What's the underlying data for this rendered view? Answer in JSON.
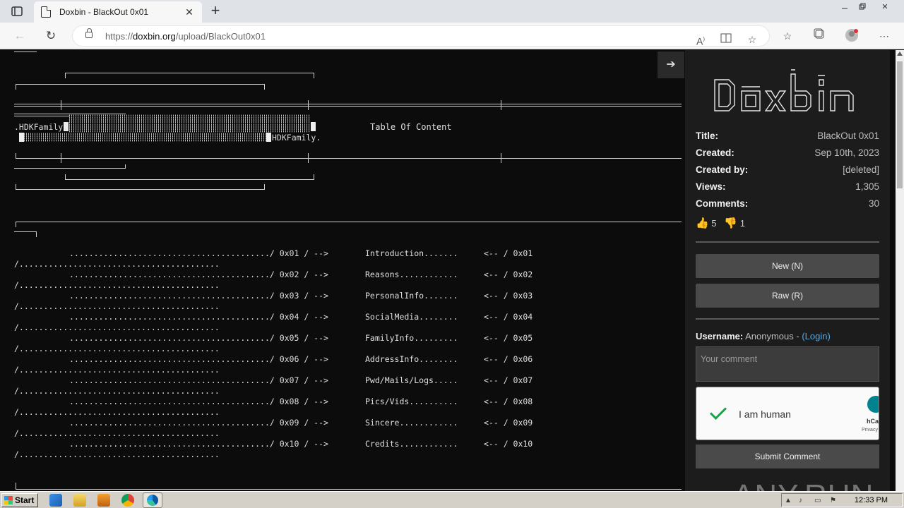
{
  "browser": {
    "tab_title": "Doxbin - BlackOut 0x01",
    "url_prefix": "https://",
    "url_domain": "doxbin.org",
    "url_path": "/upload/BlackOut0x01"
  },
  "paste": {
    "banner_left": ".HDKFamily.",
    "banner_right": "HDKFamily.",
    "banner_heading": "Table Of Content",
    "toc": [
      {
        "lead": "........................................./ 0x01 / -->",
        "trail": "/.........................................",
        "name": "Introduction.......",
        "ref": "<-- / 0x01"
      },
      {
        "lead": "........................................./ 0x02 / -->",
        "trail": "/.........................................",
        "name": "Reasons............",
        "ref": "<-- / 0x02"
      },
      {
        "lead": "........................................./ 0x03 / -->",
        "trail": "/.........................................",
        "name": "PersonalInfo.......",
        "ref": "<-- / 0x03"
      },
      {
        "lead": "........................................./ 0x04 / -->",
        "trail": "/.........................................",
        "name": "SocialMedia........",
        "ref": "<-- / 0x04"
      },
      {
        "lead": "........................................./ 0x05 / -->",
        "trail": "/.........................................",
        "name": "FamilyInfo.........",
        "ref": "<-- / 0x05"
      },
      {
        "lead": "........................................./ 0x06 / -->",
        "trail": "/.........................................",
        "name": "AddressInfo........",
        "ref": "<-- / 0x06"
      },
      {
        "lead": "........................................./ 0x07 / -->",
        "trail": "/.........................................",
        "name": "Pwd/Mails/Logs.....",
        "ref": "<-- / 0x07"
      },
      {
        "lead": "........................................./ 0x08 / -->",
        "trail": "/.........................................",
        "name": "Pics/Vids..........",
        "ref": "<-- / 0x08"
      },
      {
        "lead": "........................................./ 0x09 / -->",
        "trail": "/.........................................",
        "name": "Sincere............",
        "ref": "<-- / 0x09"
      },
      {
        "lead": "........................................./ 0x10 / -->",
        "trail": "/.........................................",
        "name": "Credits............",
        "ref": "<-- / 0x10"
      }
    ]
  },
  "sidebar": {
    "meta": [
      {
        "key": "Title:",
        "value": "BlackOut 0x01"
      },
      {
        "key": "Created:",
        "value": "Sep 10th, 2023"
      },
      {
        "key": "Created by:",
        "value": "[deleted]"
      },
      {
        "key": "Views:",
        "value": "1,305"
      },
      {
        "key": "Comments:",
        "value": "30"
      }
    ],
    "likes": "5",
    "dislikes": "1",
    "new_button": "New (N)",
    "raw_button": "Raw (R)",
    "username_label": "Username:",
    "username_value": "Anonymous -",
    "login_link": "(Login)",
    "comment_placeholder": "Your comment",
    "captcha_label": "I am human",
    "captcha_brand": "hCa",
    "captcha_privacy": "Privacy",
    "submit_button": "Submit Comment"
  },
  "watermark": "ANY.RUN",
  "taskbar": {
    "start_label": "Start",
    "clock": "12:33 PM"
  }
}
